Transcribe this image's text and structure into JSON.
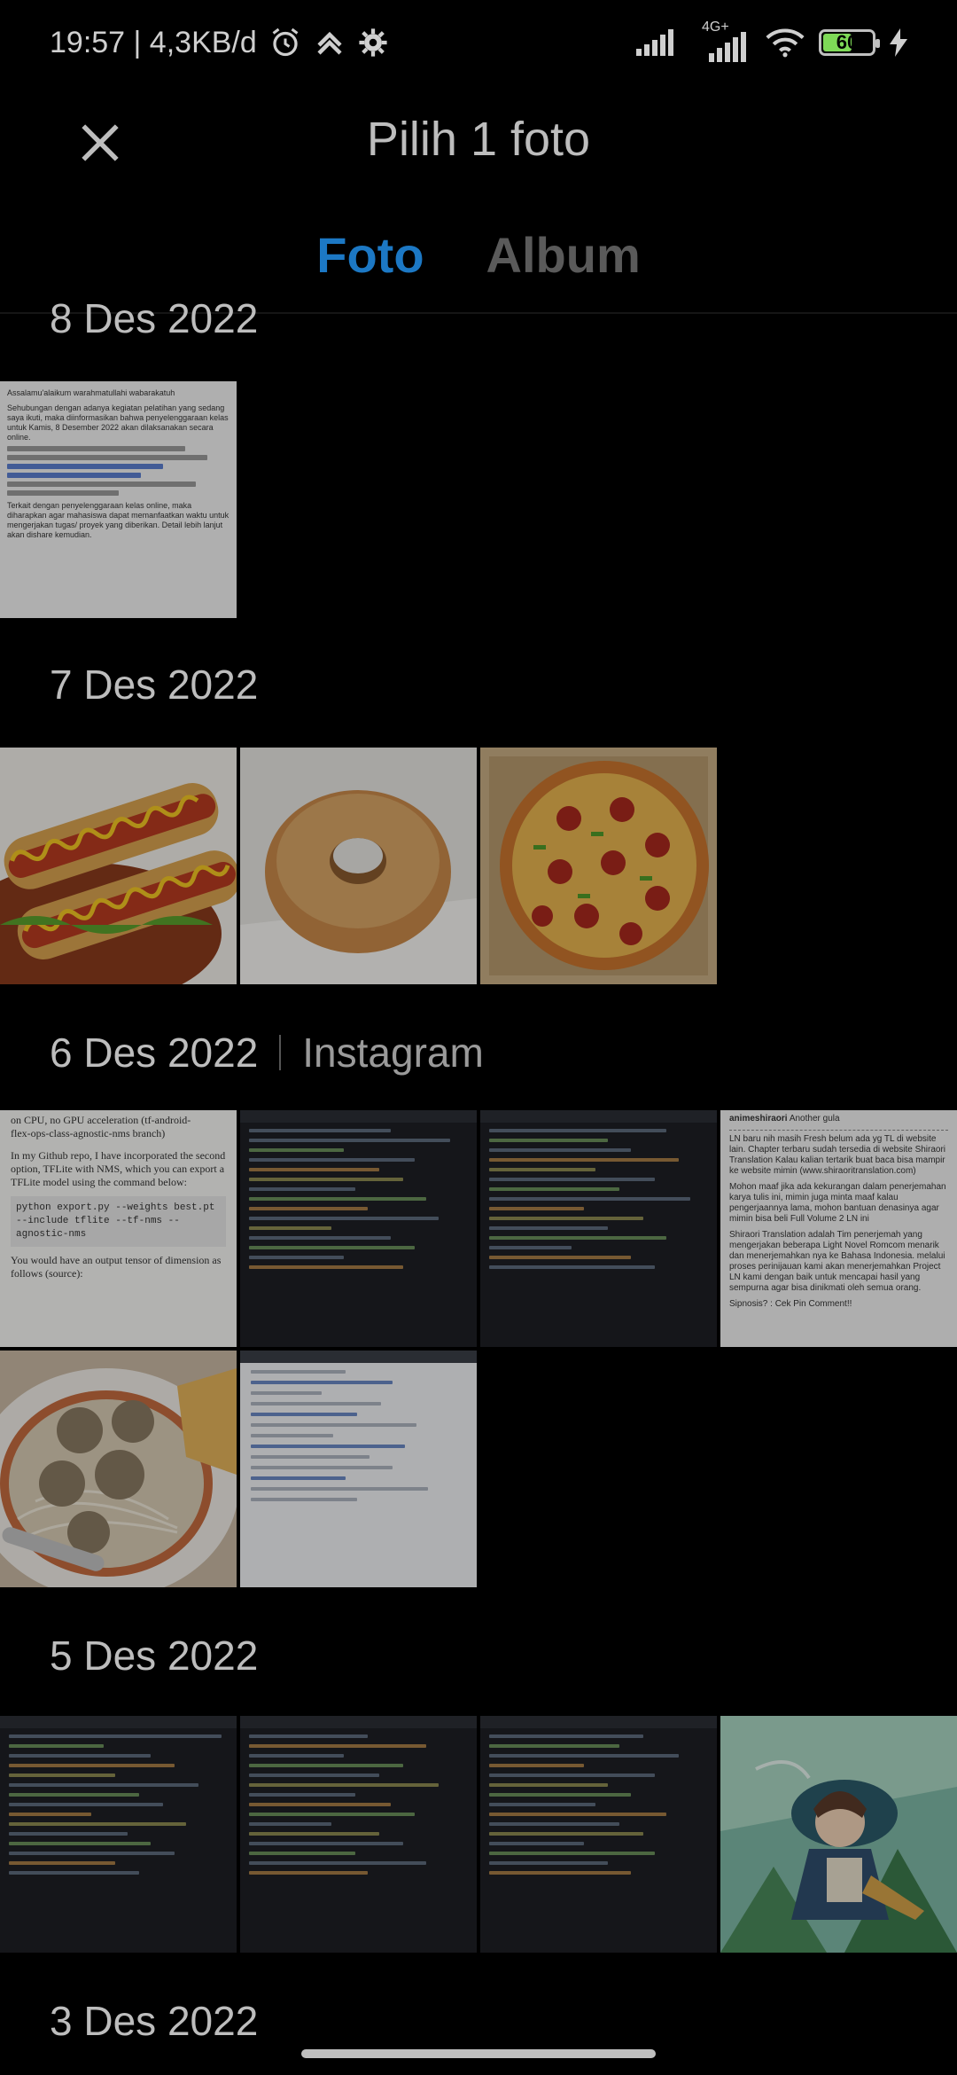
{
  "status_bar": {
    "time_info": "19:57 | 4,3KB/d",
    "network_label": "4G+",
    "battery": "60",
    "battery_level": 0.6
  },
  "header": {
    "title": "Pilih 1 foto",
    "close_icon": "close-icon"
  },
  "tabs": [
    {
      "label": "Foto",
      "active": true
    },
    {
      "label": "Album",
      "active": false
    }
  ],
  "sections": [
    {
      "date": "8 Des 2022",
      "source": "",
      "photos": [
        "Classroom announcement screenshot"
      ]
    },
    {
      "date": "7 Des 2022",
      "source": "",
      "photos": [
        "Hot dogs",
        "Sugar donut",
        "Pepperoni pizza"
      ]
    },
    {
      "date": "6 Des 2022",
      "source": "Instagram",
      "photos": [
        "TFLite article screenshot",
        "Code editor screenshot",
        "Code editor screenshot",
        "Translation announcement screenshot",
        "Meatball soup",
        "IDE screenshot"
      ]
    },
    {
      "date": "5 Des 2022",
      "source": "",
      "photos": [
        "Code editor screenshot",
        "Code editor screenshot",
        "Code editor screenshot",
        "Anime character illustration"
      ]
    },
    {
      "date": "3 Des 2022",
      "source": "",
      "photos": []
    }
  ],
  "thumb_text": {
    "article_line1": "on CPU, no GPU acceleration (tf-android-",
    "article_line2": "flex-ops-class-agnostic-nms branch)",
    "article_para": "In my Github repo, I have incorporated the second option, TFLite with NMS, which you can export a TFLite model using the command below:",
    "article_code": "python export.py --weights best.pt --include tflite --tf-nms --agnostic-nms",
    "article_tail": "You would have an output tensor of dimension as follows (source):",
    "announce_name": "animeshiraori",
    "announce_tag": "Another gula",
    "announce_body1": "LN baru nih masih Fresh belum ada yg TL di website lain. Chapter terbaru sudah tersedia di website Shiraori Translation Kalau kalian tertarik buat baca bisa mampir ke website mimin (www.shiraoritranslation.com)",
    "announce_body2": "Mohon maaf jika ada kekurangan dalam penerjemahan karya tulis ini, mimin juga minta maaf kalau pengerjaannya lama, mohon bantuan denasinya agar mimin bisa beli Full Volume 2 LN ini",
    "announce_body3": "Shiraori Translation adalah Tim penerjemah yang mengerjakan beberapa Light Novel Romcom menarik dan menerjemahkan nya ke Bahasa Indonesia. melalui proses perinijauan kami akan menerjemahkan Project LN kami dengan baik untuk mencapai hasil yang sempurna agar bisa dinikmati oleh semua orang.",
    "announce_footer": "Sipnosis? : Cek Pin Comment!!",
    "classroom_greeting": "Assalamu'alaikum warahmatullahi wabarakatuh",
    "classroom_body": "Sehubungan dengan adanya kegiatan pelatihan yang sedang saya ikuti, maka diinformasikan bahwa penyelenggaraan kelas untuk Kamis, 8 Desember 2022 akan dilaksanakan secara online.",
    "classroom_note": "Terkait dengan penyelenggaraan kelas online, maka diharapkan agar mahasiswa dapat memanfaatkan waktu untuk mengerjakan tugas/ proyek yang diberikan. Detail lebih lanjut akan dishare kemudian."
  }
}
